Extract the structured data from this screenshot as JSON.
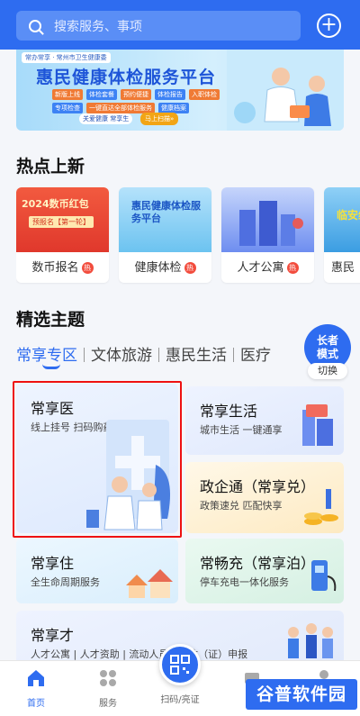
{
  "search": {
    "placeholder": "搜索服务、事项"
  },
  "banner": {
    "title": "惠民健康体检服务平台",
    "org": "常办常享 · 常州市卫生健康委",
    "tags": [
      "新版上线",
      "体检套餐",
      "预约便捷",
      "体检报告",
      "入职体检",
      "专项检查",
      "一键直达全部体检服务",
      "健康档案"
    ],
    "slogan": "关爱健康 常享生",
    "cta": "马上扫描»"
  },
  "hot": {
    "title": "热点上新",
    "badge": "热",
    "cards": [
      {
        "label": "数币报名",
        "img_text": "2024数币红包",
        "img_sub": "预报名【第一轮】",
        "color": "#e8483a"
      },
      {
        "label": "健康体检",
        "img_text": "惠民健康体检服务平台",
        "img_sub": "",
        "color": "#5fbcef"
      },
      {
        "label": "人才公寓",
        "img_text": "",
        "img_sub": "",
        "color": "#7d9bf0"
      },
      {
        "label": "惠民",
        "img_text": "临安纯玩",
        "img_sub": "",
        "color": "#4aa6e8"
      }
    ]
  },
  "themes": {
    "title": "精选主题",
    "tabs": [
      "常享专区",
      "文体旅游",
      "惠民生活",
      "医疗"
    ],
    "elder": {
      "line1": "长者",
      "line2": "模式",
      "switch": "切换"
    }
  },
  "cards": {
    "medical": {
      "title": "常享医",
      "sub": "线上挂号 扫码购药"
    },
    "life": {
      "title": "常享生活",
      "sub": "城市生活 一键通享"
    },
    "gov": {
      "title": "政企通（常享兑）",
      "sub": "政策速兑 匹配快享"
    },
    "housing": {
      "title": "常享住",
      "sub": "全生命周期服务"
    },
    "charging": {
      "title": "常畅充（常享泊）",
      "sub": "停车充电一体化服务"
    },
    "talent": {
      "title": "常享才",
      "sub": "人才公寓 | 人才资助 | 流动人员 | 居住（证）申报"
    }
  },
  "nav": {
    "home": "首页",
    "service": "服务",
    "scan": "扫码/亮证",
    "watermark": "谷普软件园"
  },
  "colors": {
    "primary": "#2e6cf0",
    "highlight": "#ee1111"
  }
}
